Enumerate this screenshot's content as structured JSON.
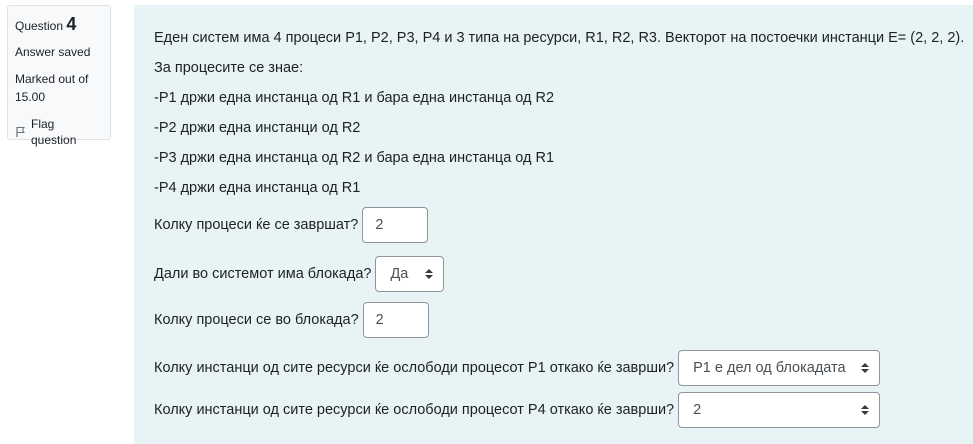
{
  "info": {
    "question_prefix": "Question",
    "question_number": "4",
    "state": "Answer saved",
    "grade": "Marked out of 15.00",
    "flag_label": "Flag question"
  },
  "question": {
    "intro": "Еден систем има 4 процеси P1, P2, P3, P4 и 3 типа на ресурси, R1, R2, R3. Векторот на постоечки инстанци E= (2, 2, 2).",
    "known": "За процесите се знае:",
    "facts": [
      "-P1 држи една инстанца од R1 и бара една инстанца од R2",
      "-P2 држи една инстанци од R2",
      "-P3 држи една инстанца од R2 и бара една инстанца од R1",
      "-P4 држи една инстанца од R1"
    ],
    "q1": {
      "label": "Колку процеси ќе се завршат?",
      "value": "2"
    },
    "q2": {
      "label": "Дали во системот има блокада?",
      "selected": "Да"
    },
    "q3": {
      "label": "Колку процеси се во блокада?",
      "value": "2"
    },
    "q4": {
      "label": "Колку инстанци од сите ресурси ќе ослободи процесот P1 откако ќе заврши?",
      "selected": "P1 е дел од блокадата"
    },
    "q5": {
      "label": "Колку инстанци од сите ресурси ќе ослободи процесот P4 откако ќе заврши?",
      "selected": "2"
    }
  },
  "colors": {
    "content_bg": "#e7f3f5",
    "info_bg": "#f8f9fa",
    "border": "#8f959e"
  }
}
